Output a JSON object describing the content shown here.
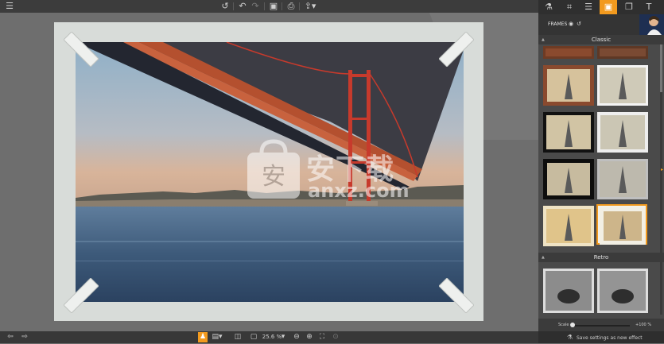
{
  "toolbar": {
    "menu_icon": "menu-icon",
    "buttons": [
      "rotate-icon",
      "undo-icon",
      "redo-icon",
      "save-icon",
      "print-icon",
      "share-icon"
    ]
  },
  "panel": {
    "tabs": [
      "flask-icon",
      "crop-icon",
      "sliders-icon",
      "frames-icon",
      "layers-icon",
      "text-icon"
    ],
    "active_tab": "frames-icon",
    "header_label": "FRAMES",
    "sections": {
      "classic": "Classic",
      "retro": "Retro"
    },
    "scale_label": "Scale",
    "scale_value": "+100 %",
    "save_label": "Save settings as new effect"
  },
  "bottom": {
    "zoom": "25.6 %"
  },
  "watermark": {
    "text": "安下载",
    "sub": "anxz.com"
  },
  "colors": {
    "accent": "#f29a1e",
    "panel_bg": "#4a4a4a",
    "canvas_bg": "#6e6e6e"
  }
}
